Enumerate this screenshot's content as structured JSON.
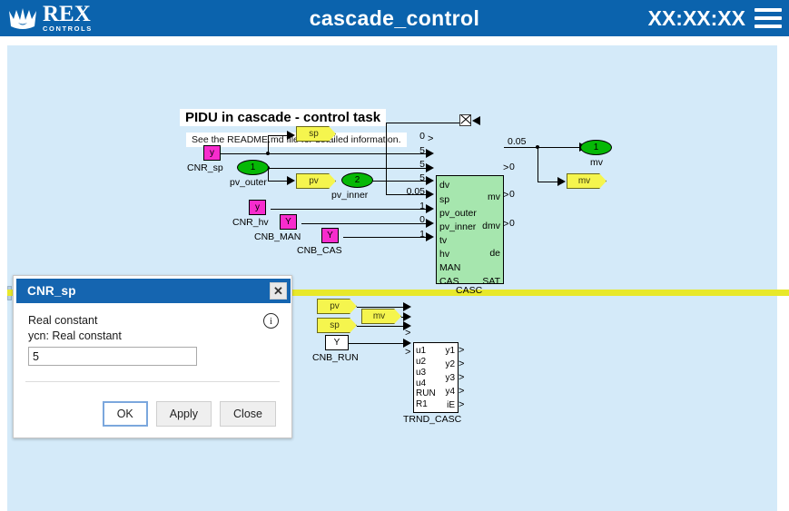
{
  "header": {
    "logo_name": "REX",
    "logo_sub": "CONTROLS",
    "title": "cascade_control",
    "clock": "XX:XX:XX",
    "menu_icon": "hamburger-icon"
  },
  "diagram": {
    "title": "PIDU in cascade - control task",
    "note": "See the README.md file for detailed information.",
    "blocks": {
      "cnr_sp": {
        "symbol": "y",
        "label": "CNR_sp"
      },
      "cnr_hv": {
        "symbol": "y",
        "label": "CNR_hv"
      },
      "cnb_man": {
        "symbol": "Y",
        "label": "CNB_MAN"
      },
      "cnb_cas": {
        "symbol": "Y",
        "label": "CNB_CAS"
      },
      "cnb_run": {
        "symbol": "Y",
        "label": "CNB_RUN"
      },
      "pv_outer": {
        "symbol": "1",
        "label": "pv_outer"
      },
      "pv_inner": {
        "symbol": "2",
        "label": "pv_inner"
      },
      "mv_out": {
        "symbol": "1",
        "label": "mv"
      },
      "tag_sp": "sp",
      "tag_pv": "pv",
      "tag_mv": "mv",
      "tag_pv2": "pv",
      "tag_sp2": "sp",
      "tag_mv2": "mv"
    },
    "casc": {
      "label": "CASC",
      "inputs": [
        "dv",
        "sp",
        "pv_outer",
        "pv_inner",
        "tv",
        "hv",
        "MAN",
        "CAS"
      ],
      "input_values": [
        "0",
        "5",
        "5",
        "5",
        "0.05",
        "1",
        "0",
        "1"
      ],
      "outputs": [
        "mv",
        "dmv",
        "de",
        "SAT"
      ],
      "output_values": [
        "0.05",
        "0",
        "0",
        "0"
      ]
    },
    "trnd": {
      "label": "TRND_CASC",
      "inputs": [
        "u1",
        "u2",
        "u3",
        "u4",
        "RUN",
        "R1"
      ],
      "outputs": [
        "y1",
        "y2",
        "y3",
        "y4",
        "iE"
      ]
    }
  },
  "dialog": {
    "title": "CNR_sp",
    "close_icon": "close-icon",
    "info_icon": "info-icon",
    "description": "Real constant",
    "param_label": "ycn: Real constant",
    "param_value": "5",
    "param_placeholder": "",
    "buttons": {
      "ok": "OK",
      "apply": "Apply",
      "close": "Close"
    }
  },
  "colors": {
    "header_bg": "#0b63ad",
    "canvas_bg": "#d4eaf9",
    "block_magenta": "#f72ccd",
    "block_green": "#06b806",
    "tag_yellow": "#f5f54e",
    "fb_green": "#a6e6ae",
    "highlight": "#e8e82a",
    "dialog_title": "#1565b0"
  }
}
